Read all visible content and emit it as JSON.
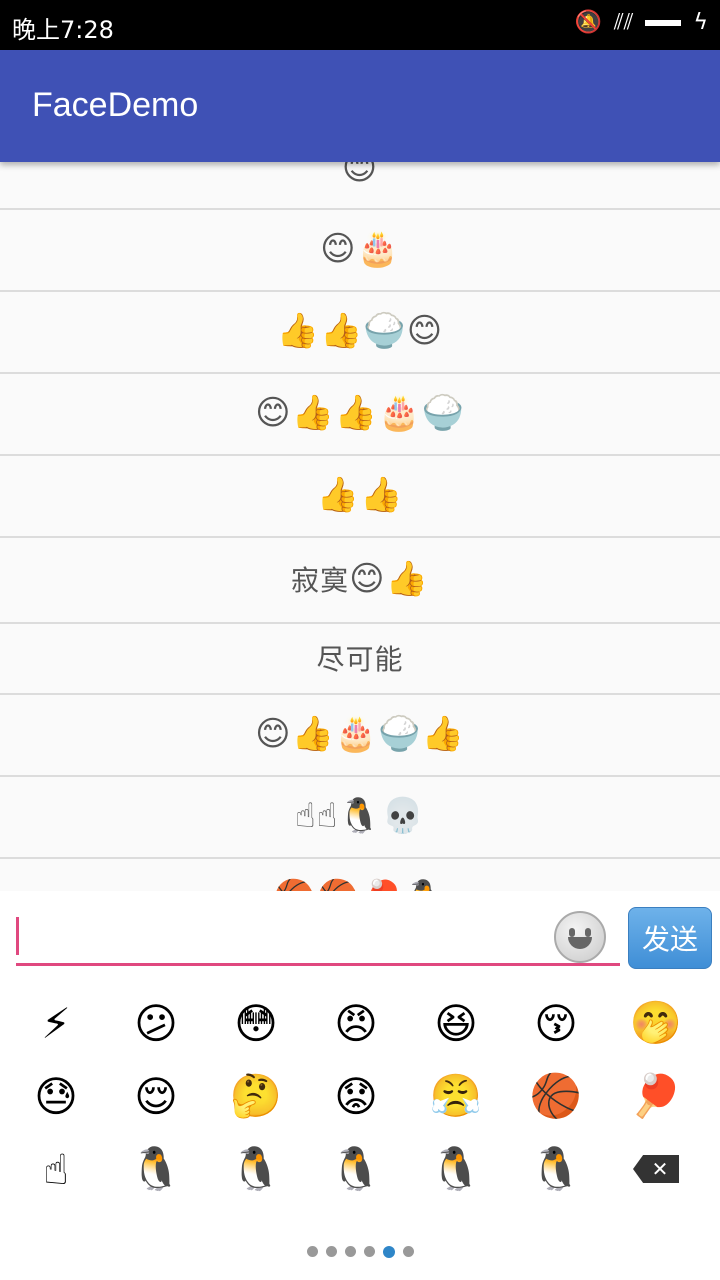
{
  "status_bar": {
    "time": "晚上7:28",
    "icons": [
      "mute-icon",
      "signal-icon",
      "battery-icon"
    ]
  },
  "app_bar": {
    "title": "FaceDemo"
  },
  "messages": [
    {
      "text": "",
      "emojis": "😊"
    },
    {
      "text": "",
      "emojis": "😊🎂"
    },
    {
      "text": "",
      "emojis": "👍👍🍚😊"
    },
    {
      "text": "",
      "emojis": "😊👍👍🎂🍚"
    },
    {
      "text": "",
      "emojis": "👍👍"
    },
    {
      "text": "寂寞",
      "emojis": "😊👍"
    },
    {
      "text": "尽可能",
      "emojis": ""
    },
    {
      "text": "",
      "emojis": "😊👍🎂🍚👍"
    },
    {
      "text": "",
      "emojis": "☝☝🐧💀"
    },
    {
      "text": "",
      "emojis": "🏀🏀🏓🐧"
    }
  ],
  "composer": {
    "input_value": "",
    "send_label": "发送"
  },
  "emoji_panel": {
    "rows": [
      [
        "⚡",
        "😕",
        "😳",
        "😠",
        "😆",
        "😚",
        "🤭"
      ],
      [
        "😓",
        "😌",
        "🤔",
        "😟",
        "😤",
        "🏀",
        "🏓"
      ],
      [
        "☝",
        "🐧",
        "🐧",
        "🐧",
        "🐧",
        "🐧",
        "⌫"
      ]
    ],
    "page_count": 6,
    "active_page": 5
  },
  "colors": {
    "app_bar": "#3f51b5",
    "accent": "#e0487f",
    "send_button": "#4a9be0"
  }
}
